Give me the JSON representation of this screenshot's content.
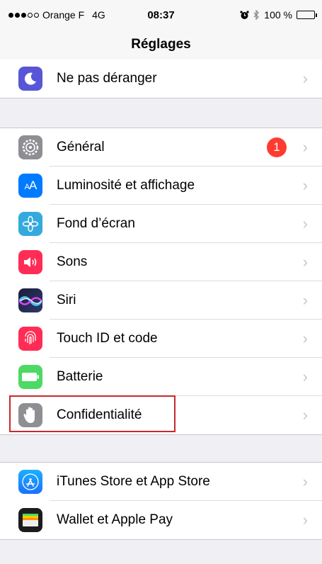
{
  "status_bar": {
    "carrier": "Orange F",
    "network": "4G",
    "time": "08:37",
    "battery": "100 %"
  },
  "nav": {
    "title": "Réglages"
  },
  "groups": [
    {
      "items": [
        {
          "label": "Ne pas déranger",
          "icon": "moon-icon",
          "color": "#5856d6"
        }
      ]
    },
    {
      "items": [
        {
          "label": "Général",
          "icon": "gear-icon",
          "color": "#8e8e93",
          "badge": "1"
        },
        {
          "label": "Luminosité et affichage",
          "icon": "text-size-icon",
          "color": "#007aff"
        },
        {
          "label": "Fond d’écran",
          "icon": "flower-icon",
          "color": "#34aadc"
        },
        {
          "label": "Sons",
          "icon": "speaker-icon",
          "color": "#ff2d55"
        },
        {
          "label": "Siri",
          "icon": "siri-icon",
          "color": "#1c1c3a"
        },
        {
          "label": "Touch ID et code",
          "icon": "fingerprint-icon",
          "color": "#ff2d55"
        },
        {
          "label": "Batterie",
          "icon": "battery-icon",
          "color": "#4cd964"
        },
        {
          "label": "Confidentialité",
          "icon": "hand-icon",
          "color": "#8e8e93"
        }
      ]
    },
    {
      "items": [
        {
          "label": "iTunes Store et App Store",
          "icon": "app-store-icon",
          "color": "#1a8cff"
        },
        {
          "label": "Wallet et Apple Pay",
          "icon": "wallet-icon",
          "color": "#1c1c1e"
        }
      ]
    }
  ],
  "annotation": {
    "highlight_color": "#c8282b",
    "highlighted_item": "Confidentialité"
  }
}
